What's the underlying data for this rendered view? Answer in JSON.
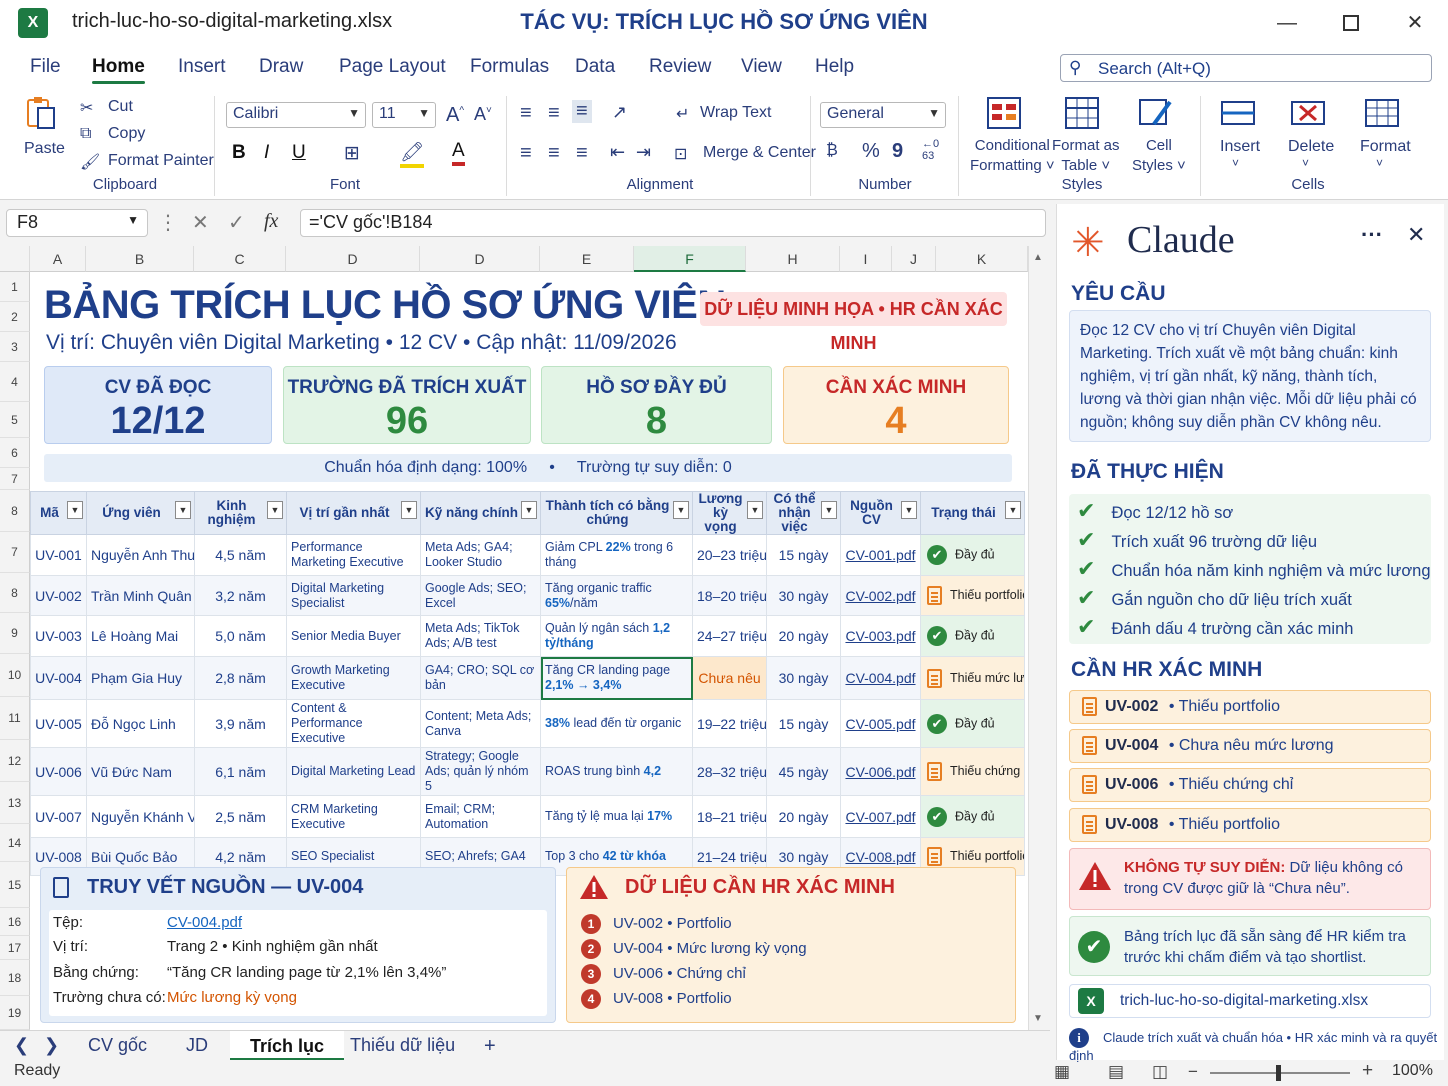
{
  "window": {
    "file_name": "trich-luc-ho-so-digital-marketing.xlsx",
    "task_title": "TÁC VỤ: TRÍCH LỤC HỒ SƠ ỨNG VIÊN",
    "excel_badge": "X"
  },
  "menu": [
    "File",
    "Home",
    "Insert",
    "Draw",
    "Page Layout",
    "Formulas",
    "Data",
    "Review",
    "View",
    "Help"
  ],
  "search": {
    "placeholder": "Search (Alt+Q)"
  },
  "ribbon": {
    "clipboard": {
      "paste": "Paste",
      "cut": "Cut",
      "copy": "Copy",
      "format_painter": "Format Painter",
      "group": "Clipboard"
    },
    "font": {
      "name": "Calibri",
      "size": "11",
      "group": "Font",
      "grow": "A^",
      "shrink": "A˅",
      "bold": "B",
      "italic": "I",
      "underline": "U"
    },
    "alignment": {
      "wrap": "Wrap Text",
      "merge": "Merge & Center",
      "group": "Alignment"
    },
    "number": {
      "format": "General",
      "group": "Number",
      "percent": "%",
      "comma": "9"
    },
    "styles": {
      "conditional": "Conditional",
      "conditional2": "Formatting",
      "format_as": "Format as",
      "format_as2": "Table",
      "cell": "Cell",
      "cell2": "Styles",
      "group": "Styles"
    },
    "cells": {
      "insert": "Insert",
      "delete": "Delete",
      "format": "Format",
      "group": "Cells"
    }
  },
  "formula_bar": {
    "cell_ref": "F8",
    "formula": "='CV gốc'!B184",
    "fx": "fx"
  },
  "columns": [
    "A",
    "B",
    "C",
    "D",
    "D",
    "E",
    "F",
    "H",
    "I",
    "J",
    "K"
  ],
  "row_numbers": [
    "1",
    "2",
    "3",
    "4",
    "5",
    "6",
    "7",
    "8",
    "7",
    "8",
    "9",
    "10",
    "11",
    "12",
    "13",
    "14",
    "15",
    "16",
    "17",
    "18",
    "19"
  ],
  "sheet": {
    "title": "BẢNG TRÍCH LỤC HỒ SƠ ỨNG VIÊN",
    "subtitle": "Vị trí: Chuyên viên Digital Marketing • 12 CV • Cập nhật: 11/09/2026",
    "badge": "DỮ LIỆU MINH HỌA • HR CẦN XÁC MINH",
    "kpis": [
      {
        "label": "CV ĐÃ ĐỌC",
        "value": "12/12"
      },
      {
        "label": "TRƯỜNG ĐÃ TRÍCH XUẤT",
        "value": "96"
      },
      {
        "label": "HỒ SƠ ĐẦY ĐỦ",
        "value": "8"
      },
      {
        "label": "CẦN XÁC MINH",
        "value": "4"
      }
    ],
    "norm_line": "Chuẩn hóa định dạng: 100%     •     Trường tự suy diễn: 0",
    "headers": [
      "Mã",
      "Ứng viên",
      "Kinh nghiệm",
      "Vị trí gần nhất",
      "Kỹ năng chính",
      "Thành tích có bằng chứng",
      "Lương kỳ vọng",
      "Có thể nhận việc",
      "Nguồn CV",
      "Trạng thái"
    ],
    "rows": [
      {
        "id": "UV-001",
        "name": "Nguyễn Anh Thư",
        "exp": "4,5 năm",
        "role": "Performance Marketing Executive",
        "skills": "Meta Ads; GA4; Looker Studio",
        "ach_pre": "Giảm CPL ",
        "ach_hl": "22%",
        "ach_post": " trong 6 tháng",
        "salary": "20–23 triệu",
        "start": "15 ngày",
        "src": "CV-001.pdf",
        "status": "Đầy đủ",
        "ok": true
      },
      {
        "id": "UV-002",
        "name": "Trần Minh Quân",
        "exp": "3,2 năm",
        "role": "Digital Marketing Specialist",
        "skills": "Google Ads; SEO; Excel",
        "ach_pre": "Tăng organic traffic ",
        "ach_hl": "65%",
        "ach_post": "/năm",
        "salary": "18–20 triệu",
        "start": "30 ngày",
        "src": "CV-002.pdf",
        "status": "Thiếu portfolio",
        "ok": false
      },
      {
        "id": "UV-003",
        "name": "Lê Hoàng Mai",
        "exp": "5,0 năm",
        "role": "Senior Media Buyer",
        "skills": "Meta Ads; TikTok Ads; A/B test",
        "ach_pre": "Quản lý ngân sách ",
        "ach_hl": "1,2 tỷ/tháng",
        "ach_post": "",
        "salary": "24–27 triệu",
        "start": "20 ngày",
        "src": "CV-003.pdf",
        "status": "Đầy đủ",
        "ok": true
      },
      {
        "id": "UV-004",
        "name": "Phạm Gia Huy",
        "exp": "2,8 năm",
        "role": "Growth Marketing Executive",
        "skills": "GA4; CRO; SQL cơ bản",
        "ach_pre": "Tăng CR landing page ",
        "ach_hl": "2,1% → 3,4%",
        "ach_post": "",
        "salary": "Chưa nêu",
        "start": "30 ngày",
        "src": "CV-004.pdf",
        "status": "Thiếu mức lương",
        "ok": false
      },
      {
        "id": "UV-005",
        "name": "Đỗ Ngọc Linh",
        "exp": "3,9 năm",
        "role": "Content & Performance Executive",
        "skills": "Content; Meta Ads; Canva",
        "ach_pre": "",
        "ach_hl": "38%",
        "ach_post": " lead đến từ organic",
        "salary": "19–22 triệu",
        "start": "15 ngày",
        "src": "CV-005.pdf",
        "status": "Đầy đủ",
        "ok": true
      },
      {
        "id": "UV-006",
        "name": "Vũ Đức Nam",
        "exp": "6,1 năm",
        "role": "Digital Marketing Lead",
        "skills": "Strategy; Google Ads; quản lý nhóm 5",
        "ach_pre": "ROAS trung bình ",
        "ach_hl": "4,2",
        "ach_post": "",
        "salary": "28–32 triệu",
        "start": "45 ngày",
        "src": "CV-006.pdf",
        "status": "Thiếu chứng chỉ",
        "ok": false
      },
      {
        "id": "UV-007",
        "name": "Nguyễn Khánh Vy",
        "exp": "2,5 năm",
        "role": "CRM Marketing Executive",
        "skills": "Email; CRM; Automation",
        "ach_pre": "Tăng tỷ lệ mua lại ",
        "ach_hl": "17%",
        "ach_post": "",
        "salary": "18–21 triệu",
        "start": "20 ngày",
        "src": "CV-007.pdf",
        "status": "Đầy đủ",
        "ok": true
      },
      {
        "id": "UV-008",
        "name": "Bùi Quốc Bảo",
        "exp": "4,2 năm",
        "role": "SEO Specialist",
        "skills": "SEO; Ahrefs; GA4",
        "ach_pre": "Top 3 cho ",
        "ach_hl": "42 từ khóa",
        "ach_post": "",
        "salary": "21–24 triệu",
        "start": "30 ngày",
        "src": "CV-008.pdf",
        "status": "Thiếu portfolio",
        "ok": false
      }
    ],
    "trace": {
      "title": "TRUY VẾT NGUỒN — UV-004",
      "lines": [
        {
          "k": "Tệp:",
          "v": "CV-004.pdf"
        },
        {
          "k": "Vị trí:",
          "v": "Trang 2  •  Kinh nghiệm gần nhất"
        },
        {
          "k": "Bằng chứng:",
          "v": "“Tăng CR landing page từ 2,1% lên 3,4%”"
        },
        {
          "k": "Trường chưa có:",
          "v": "Mức lương kỳ vọng"
        }
      ]
    },
    "verify": {
      "title": "DỮ LIỆU CẦN HR XÁC MINH",
      "items": [
        {
          "n": "1",
          "text": "UV-002  •  Portfolio"
        },
        {
          "n": "2",
          "text": "UV-004  •  Mức lương kỳ vọng"
        },
        {
          "n": "3",
          "text": "UV-006  •  Chứng chỉ"
        },
        {
          "n": "4",
          "text": "UV-008  •  Portfolio"
        }
      ]
    }
  },
  "sheet_tabs": [
    "CV gốc",
    "JD",
    "Trích lục",
    "Thiếu dữ liệu",
    "+"
  ],
  "status": {
    "ready": "Ready",
    "zoom": "100%"
  },
  "claude": {
    "name": "Claude",
    "sec_request": "YÊU CẦU",
    "request": "Đọc 12 CV cho vị trí Chuyên viên Digital Marketing. Trích xuất về một bảng chuẩn: kinh nghiệm, vị trí gần nhất, kỹ năng, thành tích, lương và thời gian nhận việc. Mỗi dữ liệu phải có nguồn; không suy diễn phần CV không nêu.",
    "sec_done": "ĐÃ THỰC HIỆN",
    "done": [
      "Đọc 12/12 hồ sơ",
      "Trích xuất 96 trường dữ liệu",
      "Chuẩn hóa năm kinh nghiệm và mức lương",
      "Gắn nguồn cho dữ liệu trích xuất",
      "Đánh dấu 4 trường cần xác minh"
    ],
    "sec_hr": "CẦN HR XÁC MINH",
    "hr": [
      {
        "id": "UV-002",
        "text": "Thiếu portfolio"
      },
      {
        "id": "UV-004",
        "text": "Chưa nêu mức lương"
      },
      {
        "id": "UV-006",
        "text": "Thiếu chứng chỉ"
      },
      {
        "id": "UV-008",
        "text": "Thiếu portfolio"
      }
    ],
    "infer_title": "KHÔNG TỰ SUY DIỄN:",
    "infer_text": " Dữ liệu không có trong CV được giữ là “Chưa nêu”.",
    "ready_text": "Bảng trích lục đã sẵn sàng để HR kiểm tra trước khi chấm điểm và tạo shortlist.",
    "file": "trich-luc-ho-so-digital-marketing.xlsx",
    "info": "Claude trích xuất và chuẩn hóa  •  HR xác minh và ra quyết định"
  },
  "colors": {
    "excel_green": "#1d7a43",
    "navy": "#1f3f8a",
    "red": "#c62828",
    "orange": "#e67e22",
    "ok_green": "#2e8a3f"
  }
}
